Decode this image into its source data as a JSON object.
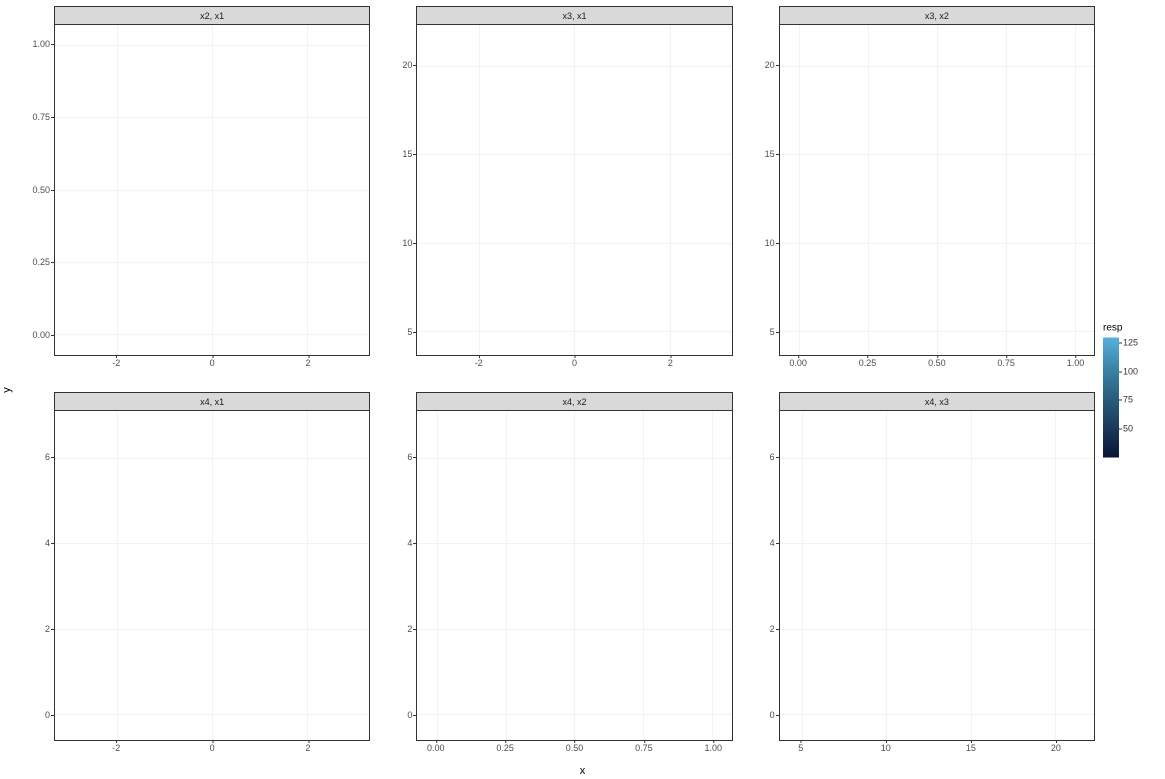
{
  "xlabel": "x",
  "ylabel": "y",
  "legend": {
    "title": "resp",
    "ticks": [
      125,
      100,
      75,
      50
    ],
    "range": [
      25,
      130
    ]
  },
  "chart_data": [
    {
      "title": "x2, x1",
      "type": "heatmap",
      "xlim": [
        -3.3,
        3.3
      ],
      "ylim": [
        -0.07,
        1.07
      ],
      "xticks": [
        -2,
        0,
        2
      ],
      "yticks": [
        0.0,
        0.25,
        0.5,
        0.75,
        1.0
      ],
      "ytick_format": "fixed2"
    },
    {
      "title": "x3, x1",
      "type": "heatmap",
      "xlim": [
        -3.3,
        3.3
      ],
      "ylim": [
        3.7,
        22.3
      ],
      "xticks": [
        -2,
        0,
        2
      ],
      "yticks": [
        5,
        10,
        15,
        20
      ],
      "ytick_format": "int"
    },
    {
      "title": "x3, x2",
      "type": "heatmap",
      "xlim": [
        -0.07,
        1.07
      ],
      "ylim": [
        3.7,
        22.3
      ],
      "xticks": [
        0.0,
        0.25,
        0.5,
        0.75,
        1.0
      ],
      "yticks": [
        5,
        10,
        15,
        20
      ],
      "xtick_format": "fixed2",
      "ytick_format": "int"
    },
    {
      "title": "x4, x1",
      "type": "heatmap",
      "xlim": [
        -3.3,
        3.3
      ],
      "ylim": [
        -0.6,
        7.1
      ],
      "xticks": [
        -2,
        0,
        2
      ],
      "yticks": [
        0,
        2,
        4,
        6
      ],
      "ytick_format": "int"
    },
    {
      "title": "x4, x2",
      "type": "heatmap",
      "xlim": [
        -0.07,
        1.07
      ],
      "ylim": [
        -0.6,
        7.1
      ],
      "xticks": [
        0.0,
        0.25,
        0.5,
        0.75,
        1.0
      ],
      "yticks": [
        0,
        2,
        4,
        6
      ],
      "xtick_format": "fixed2",
      "ytick_format": "int"
    },
    {
      "title": "x4, x3",
      "type": "heatmap",
      "xlim": [
        3.7,
        22.3
      ],
      "ylim": [
        -0.6,
        7.1
      ],
      "xticks": [
        5,
        10,
        15,
        20
      ],
      "yticks": [
        0,
        2,
        4,
        6
      ],
      "ytick_format": "int"
    }
  ]
}
